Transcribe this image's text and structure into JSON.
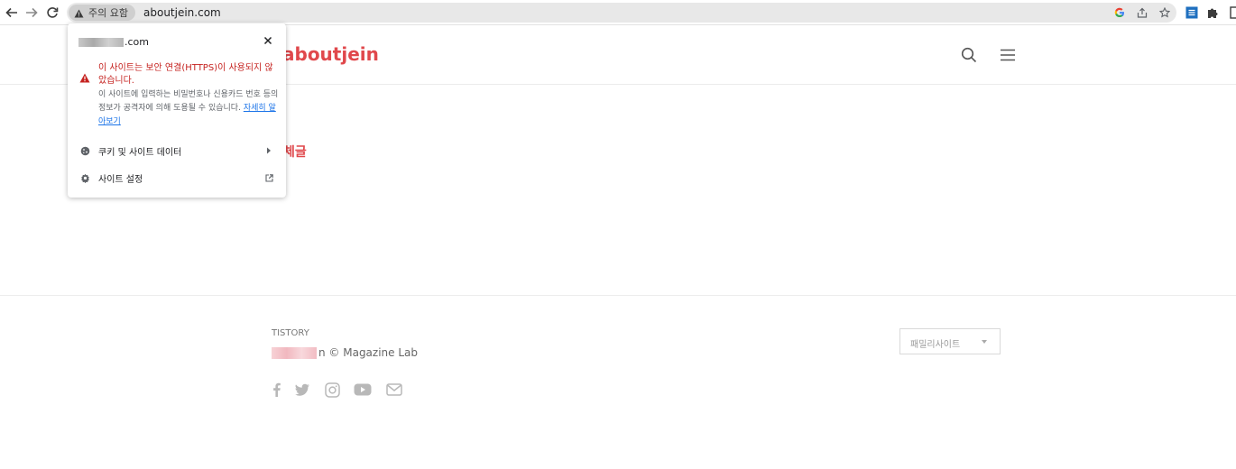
{
  "browser": {
    "security_chip": "주의 요함",
    "url": "aboutjein.com",
    "icons": [
      "back-icon",
      "forward-icon",
      "reload-icon",
      "warning-icon",
      "google-icon",
      "share-icon",
      "star-icon",
      "extension-icon",
      "puzzle-icon",
      "sidepanel-icon"
    ]
  },
  "popup": {
    "domain_suffix": ".com",
    "warning_title": "이 사이트는 보안 연결(HTTPS)이 사용되지 않았습니다.",
    "warning_body": "이 사이트에 입력하는 비밀번호나 신용카드 번호 등의 정보가 공격자에 의해 도용될 수 있습니다.",
    "learn_more": "자세히 알아보기",
    "cookies_label": "쿠키 및 사이트 데이터",
    "settings_label": "사이트 설정"
  },
  "site": {
    "logo": "aboutjein",
    "category_fragment": "체글"
  },
  "footer": {
    "brand": "TISTORY",
    "copyright_suffix": "n © Magazine Lab",
    "family_site": "패밀리사이트",
    "social": [
      "facebook-icon",
      "twitter-icon",
      "instagram-icon",
      "youtube-icon",
      "mail-icon"
    ]
  },
  "colors": {
    "accent": "#e0484c",
    "warning": "#c5221f",
    "link": "#1a73e8"
  }
}
